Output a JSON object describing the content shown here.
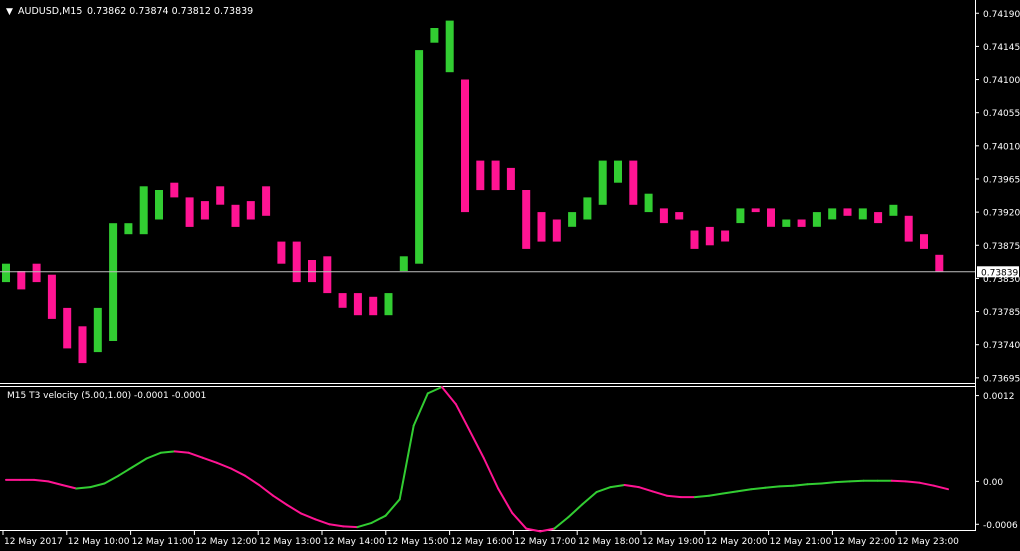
{
  "header": {
    "triangle": "▼",
    "symbol": "AUDUSD,M15",
    "quote": "0.73862 0.73874 0.73812 0.73839"
  },
  "indicator": {
    "label": "M15 T3 velocity (5.00,1.00) -0.0001 -0.0001"
  },
  "colors": {
    "background": "#000000",
    "grid": "#ffffff",
    "bull": "#32cd32",
    "bear": "#ff1493",
    "price_line": "#c0c0c0",
    "current_price_box": "#ffffff"
  },
  "chart_data": [
    {
      "type": "candlestick",
      "title": "AUDUSD,M15",
      "ylim": [
        0.73688,
        0.74208
      ],
      "y_ticks": [
        "0.74190",
        "0.74145",
        "0.74100",
        "0.74055",
        "0.74010",
        "0.73965",
        "0.73920",
        "0.73875",
        "0.73830",
        "0.73785",
        "0.73740",
        "0.73695"
      ],
      "current_price": "0.73839",
      "candles": [
        {
          "o": 0.73825,
          "c": 0.7385,
          "dir": "up"
        },
        {
          "o": 0.7384,
          "c": 0.73815,
          "dir": "down"
        },
        {
          "o": 0.7385,
          "c": 0.73825,
          "dir": "down"
        },
        {
          "o": 0.73835,
          "c": 0.73775,
          "dir": "down"
        },
        {
          "o": 0.7379,
          "c": 0.73735,
          "dir": "down"
        },
        {
          "o": 0.73765,
          "c": 0.73715,
          "dir": "down"
        },
        {
          "o": 0.7373,
          "c": 0.7379,
          "dir": "up"
        },
        {
          "o": 0.73745,
          "c": 0.73905,
          "dir": "up"
        },
        {
          "o": 0.7389,
          "c": 0.73905,
          "dir": "up"
        },
        {
          "o": 0.7389,
          "c": 0.73955,
          "dir": "up"
        },
        {
          "o": 0.7391,
          "c": 0.7395,
          "dir": "up"
        },
        {
          "o": 0.7396,
          "c": 0.7394,
          "dir": "down"
        },
        {
          "o": 0.7394,
          "c": 0.739,
          "dir": "down"
        },
        {
          "o": 0.73935,
          "c": 0.7391,
          "dir": "down"
        },
        {
          "o": 0.73955,
          "c": 0.7393,
          "dir": "down"
        },
        {
          "o": 0.7393,
          "c": 0.739,
          "dir": "down"
        },
        {
          "o": 0.73935,
          "c": 0.7391,
          "dir": "down"
        },
        {
          "o": 0.73955,
          "c": 0.73915,
          "dir": "down"
        },
        {
          "o": 0.7388,
          "c": 0.7385,
          "dir": "down"
        },
        {
          "o": 0.7388,
          "c": 0.73825,
          "dir": "down"
        },
        {
          "o": 0.73855,
          "c": 0.73825,
          "dir": "down"
        },
        {
          "o": 0.7386,
          "c": 0.7381,
          "dir": "down"
        },
        {
          "o": 0.7381,
          "c": 0.7379,
          "dir": "down"
        },
        {
          "o": 0.7381,
          "c": 0.7378,
          "dir": "down"
        },
        {
          "o": 0.73805,
          "c": 0.7378,
          "dir": "down"
        },
        {
          "o": 0.7378,
          "c": 0.7381,
          "dir": "up"
        },
        {
          "o": 0.7384,
          "c": 0.7386,
          "dir": "up"
        },
        {
          "o": 0.7385,
          "c": 0.7414,
          "dir": "up"
        },
        {
          "o": 0.7415,
          "c": 0.7417,
          "dir": "up"
        },
        {
          "o": 0.7411,
          "c": 0.7418,
          "dir": "up"
        },
        {
          "o": 0.741,
          "c": 0.7392,
          "dir": "down"
        },
        {
          "o": 0.7399,
          "c": 0.7395,
          "dir": "down"
        },
        {
          "o": 0.7399,
          "c": 0.7395,
          "dir": "down"
        },
        {
          "o": 0.7398,
          "c": 0.7395,
          "dir": "down"
        },
        {
          "o": 0.7395,
          "c": 0.7387,
          "dir": "down"
        },
        {
          "o": 0.7392,
          "c": 0.7388,
          "dir": "down"
        },
        {
          "o": 0.7391,
          "c": 0.7388,
          "dir": "down"
        },
        {
          "o": 0.739,
          "c": 0.7392,
          "dir": "up"
        },
        {
          "o": 0.7391,
          "c": 0.7394,
          "dir": "up"
        },
        {
          "o": 0.7393,
          "c": 0.7399,
          "dir": "up"
        },
        {
          "o": 0.7396,
          "c": 0.7399,
          "dir": "up"
        },
        {
          "o": 0.7399,
          "c": 0.7393,
          "dir": "down"
        },
        {
          "o": 0.7392,
          "c": 0.73945,
          "dir": "up"
        },
        {
          "o": 0.73925,
          "c": 0.73905,
          "dir": "down"
        },
        {
          "o": 0.7392,
          "c": 0.7391,
          "dir": "down"
        },
        {
          "o": 0.73895,
          "c": 0.7387,
          "dir": "down"
        },
        {
          "o": 0.739,
          "c": 0.73875,
          "dir": "down"
        },
        {
          "o": 0.73895,
          "c": 0.7388,
          "dir": "down"
        },
        {
          "o": 0.73905,
          "c": 0.73925,
          "dir": "up"
        },
        {
          "o": 0.73925,
          "c": 0.7392,
          "dir": "down"
        },
        {
          "o": 0.73925,
          "c": 0.739,
          "dir": "down"
        },
        {
          "o": 0.739,
          "c": 0.7391,
          "dir": "up"
        },
        {
          "o": 0.7391,
          "c": 0.739,
          "dir": "down"
        },
        {
          "o": 0.739,
          "c": 0.7392,
          "dir": "up"
        },
        {
          "o": 0.7391,
          "c": 0.73925,
          "dir": "up"
        },
        {
          "o": 0.73925,
          "c": 0.73915,
          "dir": "down"
        },
        {
          "o": 0.7391,
          "c": 0.73925,
          "dir": "up"
        },
        {
          "o": 0.7392,
          "c": 0.73905,
          "dir": "down"
        },
        {
          "o": 0.73915,
          "c": 0.7393,
          "dir": "up"
        },
        {
          "o": 0.73915,
          "c": 0.7388,
          "dir": "down"
        },
        {
          "o": 0.7389,
          "c": 0.7387,
          "dir": "down"
        },
        {
          "o": 0.73862,
          "c": 0.73839,
          "dir": "down"
        }
      ]
    },
    {
      "type": "line",
      "title": "M15 T3 velocity (5.00,1.00) -0.0001 -0.0001",
      "ylim": [
        -0.00068,
        0.00132
      ],
      "y_ticks": [
        "0.0012",
        "0.00",
        "-0.0006"
      ],
      "series": [
        {
          "values": [
            2e-05,
            2e-05,
            2e-05,
            0.0,
            -5e-05,
            -0.0001,
            -8e-05,
            -3e-05,
            8e-05,
            0.0002,
            0.00032,
            0.0004,
            0.00042,
            0.0004,
            0.00033,
            0.00026,
            0.00018,
            8e-05,
            -5e-05,
            -0.0002,
            -0.00033,
            -0.00045,
            -0.00053,
            -0.0006,
            -0.00063,
            -0.00064,
            -0.00058,
            -0.00048,
            -0.00025,
            0.00078,
            0.00123,
            0.00132,
            0.00108,
            0.0007,
            0.00032,
            -0.0001,
            -0.00044,
            -0.00066,
            -0.0007,
            -0.00066,
            -0.0005,
            -0.00032,
            -0.00015,
            -8e-05,
            -5e-05,
            -8e-05,
            -0.00014,
            -0.0002,
            -0.00022,
            -0.00022,
            -0.0002,
            -0.00017,
            -0.00014,
            -0.00011,
            -9e-05,
            -7e-05,
            -6e-05,
            -4e-05,
            -3e-05,
            -1e-05,
            0.0,
            1e-05,
            1e-05,
            1e-05,
            0.0,
            -2e-05,
            -6e-05,
            -0.00011
          ],
          "colors": [
            "bear",
            "bear",
            "bear",
            "bear",
            "bear",
            "bull",
            "bull",
            "bull",
            "bull",
            "bull",
            "bull",
            "bull",
            "bear",
            "bear",
            "bear",
            "bear",
            "bear",
            "bear",
            "bear",
            "bear",
            "bear",
            "bear",
            "bear",
            "bear",
            "bear",
            "bull",
            "bull",
            "bull",
            "bull",
            "bull",
            "bull",
            "bear",
            "bear",
            "bear",
            "bear",
            "bear",
            "bear",
            "bear",
            "bear",
            "bull",
            "bull",
            "bull",
            "bull",
            "bull",
            "bear",
            "bear",
            "bear",
            "bear",
            "bear",
            "bull",
            "bull",
            "bull",
            "bull",
            "bull",
            "bull",
            "bull",
            "bull",
            "bull",
            "bull",
            "bull",
            "bull",
            "bull",
            "bull",
            "bear",
            "bear",
            "bear",
            "bear",
            "bear"
          ]
        }
      ]
    }
  ],
  "x_axis": {
    "labels": [
      "12 May 2017",
      "12 May 10:00",
      "12 May 11:00",
      "12 May 12:00",
      "12 May 13:00",
      "12 May 14:00",
      "12 May 15:00",
      "12 May 16:00",
      "12 May 17:00",
      "12 May 18:00",
      "12 May 19:00",
      "12 May 20:00",
      "12 May 21:00",
      "12 May 22:00",
      "12 May 23:00"
    ]
  }
}
